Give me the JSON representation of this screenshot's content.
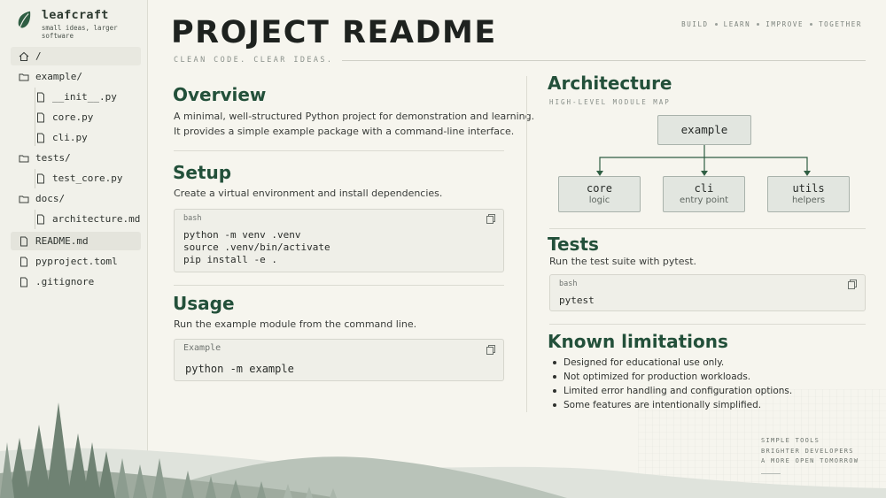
{
  "brand": {
    "name": "leafcraft",
    "tagline": "small ideas, larger software"
  },
  "sidebar": {
    "items": [
      {
        "label": "/",
        "icon": "home-icon"
      },
      {
        "label": "example/",
        "icon": "folder-icon"
      },
      {
        "label": "__init__.py",
        "icon": "file-icon"
      },
      {
        "label": "core.py",
        "icon": "file-icon"
      },
      {
        "label": "cli.py",
        "icon": "file-icon"
      },
      {
        "label": "tests/",
        "icon": "folder-icon"
      },
      {
        "label": "test_core.py",
        "icon": "file-icon"
      },
      {
        "label": "docs/",
        "icon": "folder-icon"
      },
      {
        "label": "architecture.md",
        "icon": "file-icon"
      },
      {
        "label": "README.md",
        "icon": "file-icon",
        "active": true
      },
      {
        "label": "pyproject.toml",
        "icon": "file-icon"
      },
      {
        "label": ".gitignore",
        "icon": "file-icon"
      }
    ]
  },
  "header": {
    "title": "PROJECT README",
    "subtitle": "CLEAN CODE. CLEAR IDEAS.",
    "nav": [
      "BUILD",
      "LEARN",
      "IMPROVE",
      "TOGETHER"
    ]
  },
  "overview": {
    "heading": "Overview",
    "text_line1": "A minimal, well-structured Python project for demonstration and learning.",
    "text_line2": "It provides a simple example package with a command-line interface."
  },
  "setup": {
    "heading": "Setup",
    "text": "Create a virtual environment and install dependencies.",
    "code_lang": "bash",
    "code_lines": [
      "python -m venv .venv",
      "source .venv/bin/activate",
      "pip install -e ."
    ]
  },
  "usage": {
    "heading": "Usage",
    "text": "Run the example module from the command line.",
    "code_lang": "Example",
    "code_line": "python -m example"
  },
  "architecture": {
    "heading": "Architecture",
    "subtitle": "HIGH-LEVEL MODULE MAP",
    "root": "example",
    "modules": [
      {
        "name": "core",
        "desc": "logic"
      },
      {
        "name": "cli",
        "desc": "entry point"
      },
      {
        "name": "utils",
        "desc": "helpers"
      }
    ]
  },
  "tests": {
    "heading": "Tests",
    "text": "Run the test suite with pytest.",
    "code_lang": "bash",
    "code_line": "pytest"
  },
  "limitations": {
    "heading": "Known limitations",
    "items": [
      "Designed for educational use only.",
      "Not optimized for production workloads.",
      "Limited error handling and configuration options.",
      "Some features are intentionally simplified."
    ]
  },
  "footer": {
    "lines": [
      "SIMPLE TOOLS",
      "BRIGHTER DEVELOPERS",
      "A MORE OPEN TOMORROW"
    ]
  },
  "colors": {
    "accent": "#23503a",
    "background": "#f6f5ee",
    "sidebar": "#f1f1ea",
    "code_bg": "#efefe8"
  }
}
